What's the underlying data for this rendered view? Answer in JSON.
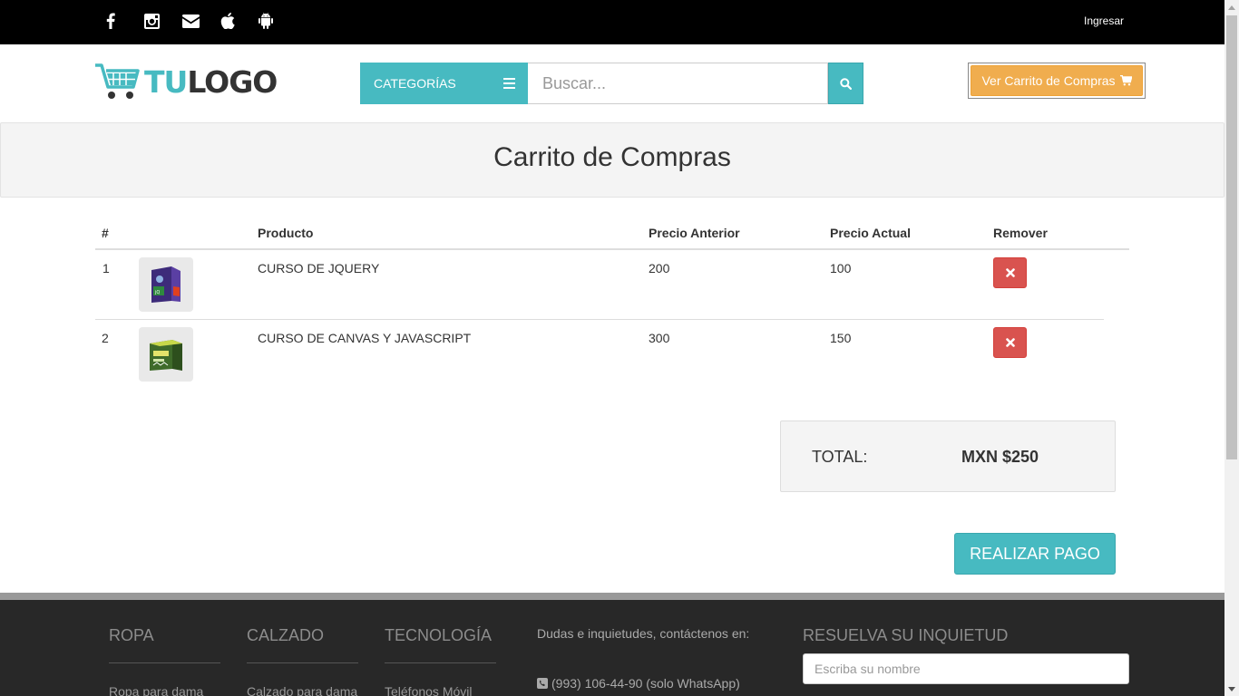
{
  "topbar": {
    "social_icons": [
      "facebook-icon",
      "instagram-icon",
      "envelope-icon",
      "apple-icon",
      "android-icon"
    ],
    "login_label": "Ingresar"
  },
  "header": {
    "logo_part1": "TU",
    "logo_part2": "LOGO",
    "categories_label": "CATEGORÍAS",
    "search_placeholder": "Buscar...",
    "cart_button_label": "Ver Carrito de Compras"
  },
  "page_title": "Carrito de Compras",
  "table": {
    "headers": {
      "num": "#",
      "product": "Producto",
      "old_price": "Precio Anterior",
      "current_price": "Precio Actual",
      "remove": "Remover"
    },
    "rows": [
      {
        "num": "1",
        "product": "CURSO DE JQUERY",
        "old_price": "200",
        "current_price": "100"
      },
      {
        "num": "2",
        "product": "CURSO DE CANVAS Y JAVASCRIPT",
        "old_price": "300",
        "current_price": "150"
      }
    ]
  },
  "summary": {
    "total_label": "TOTAL:",
    "total_value": "MXN $250",
    "pay_button": "REALIZAR PAGO"
  },
  "footer": {
    "col1_title": "ROPA",
    "col1_link": "Ropa para dama",
    "col2_title": "CALZADO",
    "col2_link": "Calzado para dama",
    "col3_title": "TECNOLOGÍA",
    "col3_link": "Teléfonos Móvil",
    "contact_text": "Dudas e inquietudes, contáctenos en:",
    "phone_text": "(993) 106-44-90 (solo WhatsApp)",
    "form_title": "RESUELVA SU INQUIETUD",
    "name_placeholder": "Escriba su nombre"
  },
  "colors": {
    "accent": "#47bac1",
    "cart_button": "#f0ad4e",
    "remove_button": "#d9534f",
    "topbar": "#000000",
    "footer": "#282828"
  }
}
